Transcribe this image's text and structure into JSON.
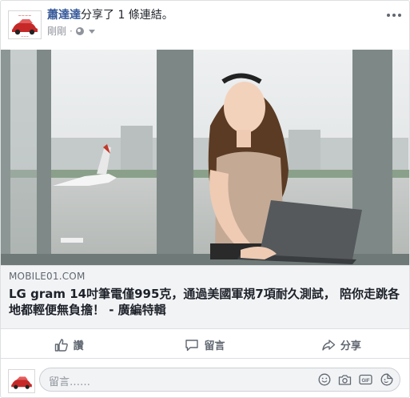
{
  "post": {
    "author": "蕭達達",
    "action_text": "分享了 1 條連結。",
    "timestamp": "剛剛",
    "privacy_icon": "globe-icon"
  },
  "link": {
    "domain": "MOBILE01.COM",
    "title": "LG gram 14吋筆電僅995克，通過美國軍規7項耐久測試， 陪你走跳各地都輕便無負擔！ - 廣編特輯"
  },
  "actions": {
    "like": "讚",
    "comment": "留言",
    "share": "分享"
  },
  "comment_box": {
    "placeholder": "留言……"
  },
  "colors": {
    "author": "#365899",
    "secondary_text": "#90949c",
    "link_bg": "#f2f3f5",
    "border": "#dddfe2"
  }
}
